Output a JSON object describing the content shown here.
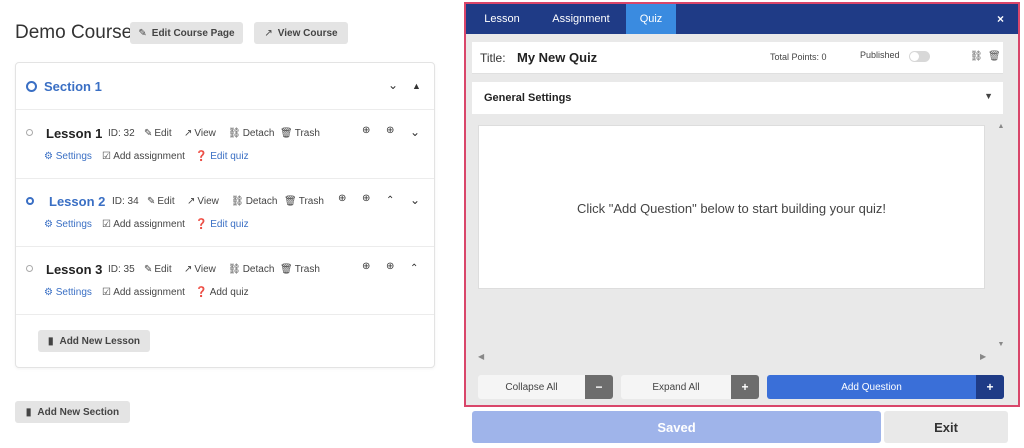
{
  "course": {
    "title": "Demo Course",
    "edit_page_label": "Edit Course Page",
    "view_course_label": "View Course"
  },
  "section": {
    "title": "Section 1",
    "lessons": [
      {
        "title": "Lesson 1",
        "id_label": "ID: 32",
        "edit": "Edit",
        "view": "View",
        "detach": "Detach",
        "trash": "Trash",
        "settings": "Settings",
        "add_assignment": "Add assignment",
        "quiz": "Edit quiz"
      },
      {
        "title": "Lesson 2",
        "id_label": "ID: 34",
        "edit": "Edit",
        "view": "View",
        "detach": "Detach",
        "trash": "Trash",
        "settings": "Settings",
        "add_assignment": "Add assignment",
        "quiz": "Edit quiz"
      },
      {
        "title": "Lesson 3",
        "id_label": "ID: 35",
        "edit": "Edit",
        "view": "View",
        "detach": "Detach",
        "trash": "Trash",
        "settings": "Settings",
        "add_assignment": "Add assignment",
        "quiz": "Add quiz"
      }
    ],
    "add_lesson_label": "Add New Lesson"
  },
  "add_section_label": "Add New Section",
  "editor": {
    "tabs": [
      "Lesson",
      "Assignment",
      "Quiz"
    ],
    "active_tab": "Quiz",
    "close_icon": "×",
    "title_label": "Title:",
    "quiz_title": "My New Quiz",
    "total_points": "Total Points: 0",
    "published_label": "Published",
    "published": false,
    "general_settings": "General Settings",
    "empty_message": "Click \"Add Question\" below to start building your quiz!",
    "collapse_all": "Collapse All",
    "expand_all": "Expand All",
    "add_question": "Add Question",
    "saved": "Saved",
    "exit": "Exit"
  },
  "colors": {
    "accent_blue": "#3a6fc4",
    "tabbar_navy": "#1f3b86",
    "tab_active": "#3a8be0",
    "highlight_border": "#d9466a",
    "saved_button": "#9fb4ea"
  }
}
